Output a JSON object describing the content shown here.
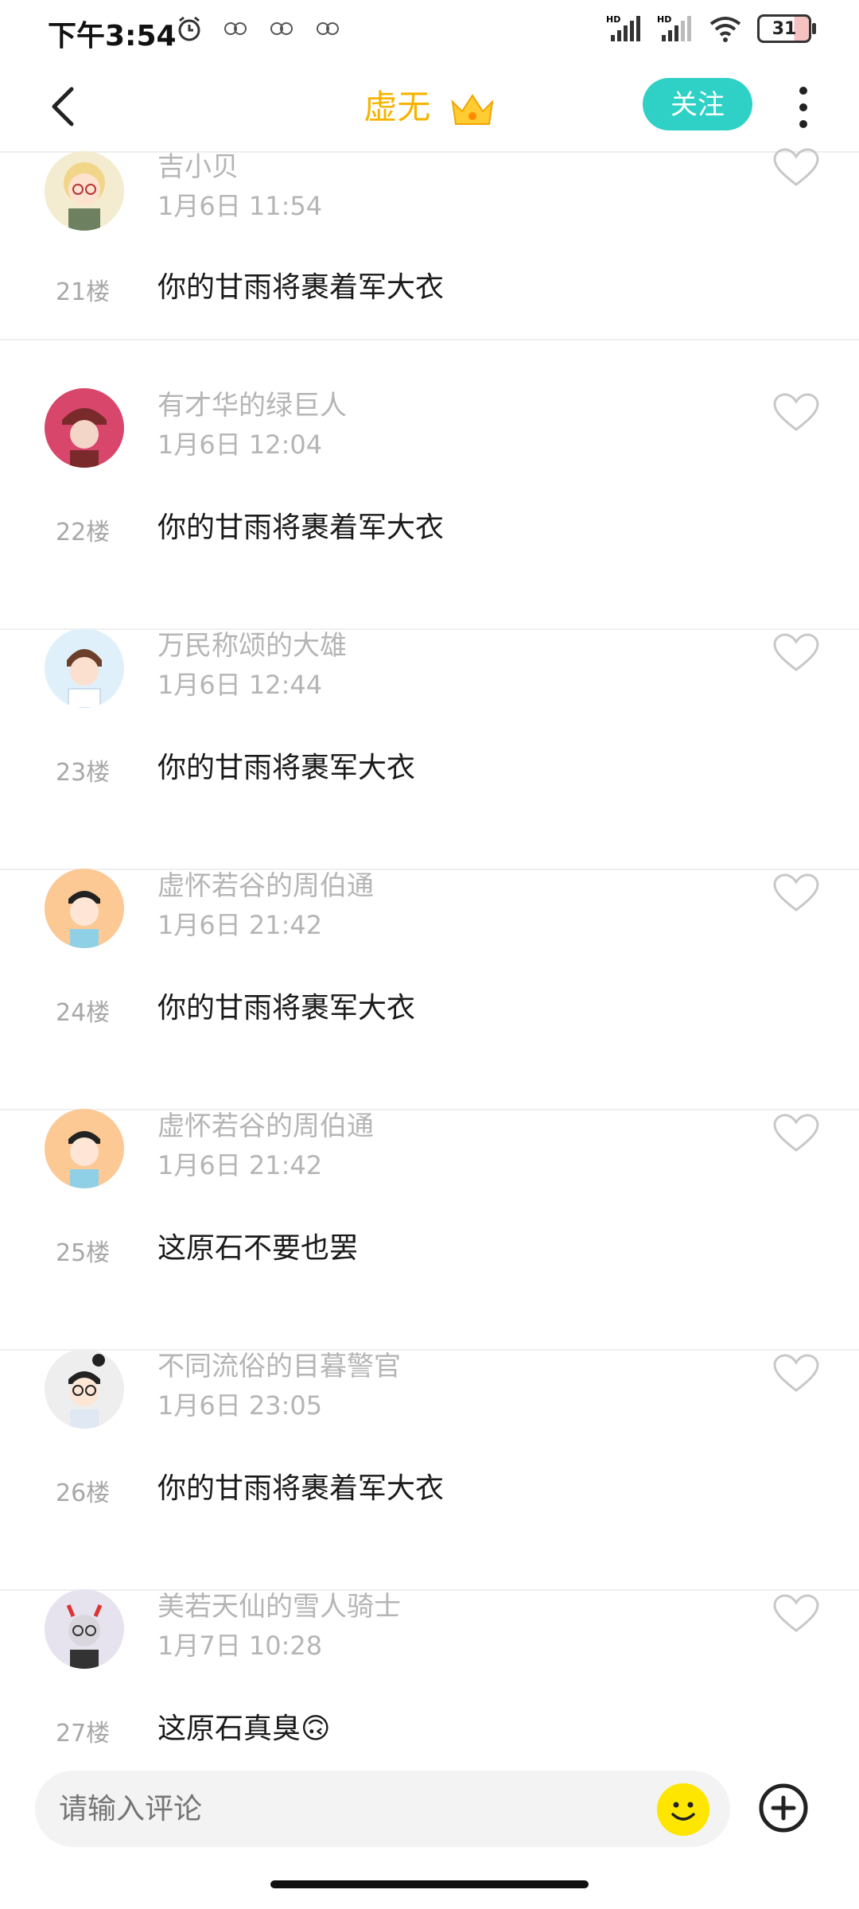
{
  "status_bar": {
    "time": "下午3:54",
    "battery": "31",
    "network_left": "HD",
    "network_right": "HD"
  },
  "header": {
    "title": "虚无",
    "follow_label": "关注"
  },
  "comments": [
    {
      "user": "吉小贝",
      "time": "1月6日 11:54",
      "floor": "21楼",
      "text": "你的甘雨将裹着军大衣"
    },
    {
      "user": "有才华的绿巨人",
      "time": "1月6日 12:04",
      "floor": "22楼",
      "text": "你的甘雨将裹着军大衣"
    },
    {
      "user": "万民称颂的大雄",
      "time": "1月6日 12:44",
      "floor": "23楼",
      "text": "你的甘雨将裹军大衣"
    },
    {
      "user": "虚怀若谷的周伯通",
      "time": "1月6日 21:42",
      "floor": "24楼",
      "text": "你的甘雨将裹军大衣"
    },
    {
      "user": "虚怀若谷的周伯通",
      "time": "1月6日 21:42",
      "floor": "25楼",
      "text": "这原石不要也罢"
    },
    {
      "user": "不同流俗的目暮警官",
      "time": "1月6日 23:05",
      "floor": "26楼",
      "text": "你的甘雨将裹着军大衣"
    },
    {
      "user": "美若天仙的雪人骑士",
      "time": "1月7日 10:28",
      "floor": "27楼",
      "text": "这原石真臭🙃"
    }
  ],
  "input": {
    "placeholder": "请输入评论"
  },
  "colors": {
    "accent": "#2fd1c6",
    "title": "#f5b400",
    "meta": "#b5b5b5"
  }
}
